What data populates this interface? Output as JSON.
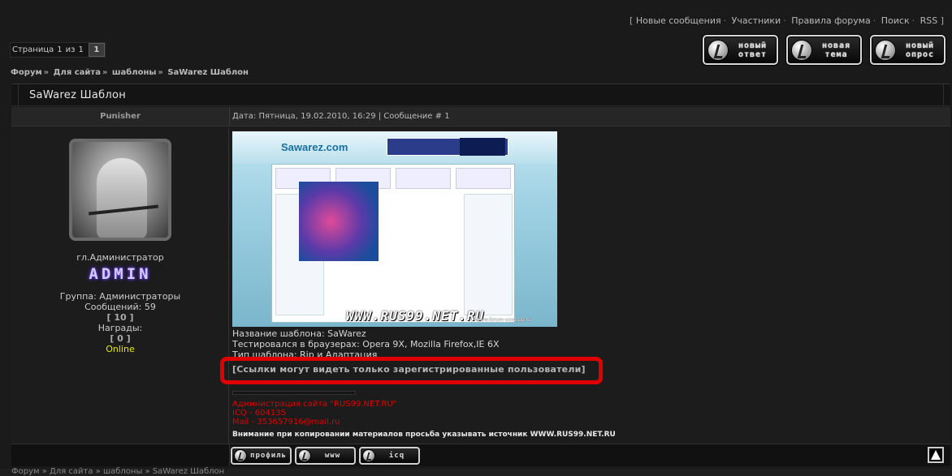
{
  "topnav": {
    "open_bracket": "[",
    "items": [
      "Новые сообщения",
      "Участники",
      "Правила форума",
      "Поиск",
      "RSS"
    ],
    "close_bracket": "]"
  },
  "pager": {
    "label_page": "Страница",
    "current": "1",
    "label_of": "из",
    "total": "1",
    "button": "1"
  },
  "action_buttons": {
    "reply": "новый ответ",
    "topic": "новая тема",
    "poll": "новый опрос"
  },
  "breadcrumb": {
    "items": [
      "Форум",
      "Для сайта",
      "шаблоны",
      "SaWarez Шаблон"
    ],
    "separator": "»"
  },
  "thread": {
    "title": "SaWarez Шаблон"
  },
  "post": {
    "author": "Punisher",
    "date_label": "Дата: Пятница, 19.02.2010, 16:29",
    "msg_label": "Сообщение #",
    "msg_num": "1",
    "rank": "гл.Администратор",
    "rank_badge": "ADMIN",
    "group": "Группа: Администраторы",
    "messages": "Сообщений: 59",
    "rep": "[ 10 ]",
    "awards_label": "Награды:",
    "awards": "[ 0 ]",
    "status": "Online",
    "screenshot": {
      "logo": "Sawarez.com",
      "watermark": "WWW.RUS99.NET.RU",
      "watermark_small": "www.forum-ucoz.pp.ru"
    },
    "template_name": "Название шаблона: SaWarez",
    "browsers": "Тестировался в браузерах: Opera 9X, Mozilla Firefox,IE 6X",
    "type": "Тип шаблона: Rip и Адаптация",
    "reg_link": "[Ссылки могут видеть только зарегистрированные пользователи]",
    "contact1": "Администрация сайта \"RUS99.NET.RU\"",
    "contact2": "ICQ - 604135",
    "contact3": "Mail - 353657916@mail.ru",
    "notice": "Внимание при копировании материалов просьба указывать источник WWW.RUS99.NET.RU"
  },
  "footer_buttons": {
    "profile": "профиль",
    "www": "www",
    "icq": "icq"
  },
  "bottom_text": "Форум » Для сайта » шаблоны » SaWarez Шаблон",
  "colors": {
    "background": "#1a1a1a",
    "red_highlight": "#e00000",
    "online": "#e8e800"
  }
}
